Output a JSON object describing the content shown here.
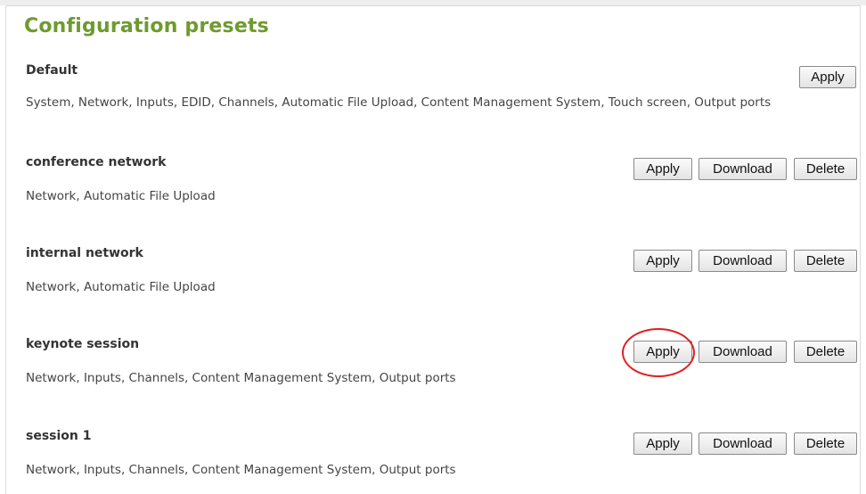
{
  "page": {
    "title": "Configuration presets"
  },
  "presets": [
    {
      "name": "Default",
      "description": "System, Network, Inputs, EDID, Channels, Automatic File Upload, Content Management System, Touch screen, Output ports",
      "apply_label": "Apply"
    },
    {
      "name": "conference network",
      "description": "Network, Automatic File Upload",
      "apply_label": "Apply",
      "download_label": "Download",
      "delete_label": "Delete"
    },
    {
      "name": "internal network",
      "description": "Network, Automatic File Upload",
      "apply_label": "Apply",
      "download_label": "Download",
      "delete_label": "Delete"
    },
    {
      "name": "keynote session",
      "description": "Network, Inputs, Channels, Content Management System, Output ports",
      "apply_label": "Apply",
      "download_label": "Download",
      "delete_label": "Delete"
    },
    {
      "name": "session 1",
      "description": "Network, Inputs, Channels, Content Management System, Output ports",
      "apply_label": "Apply",
      "download_label": "Download",
      "delete_label": "Delete"
    }
  ],
  "colors": {
    "title": "#6d9b2d",
    "highlight": "#e02020"
  }
}
